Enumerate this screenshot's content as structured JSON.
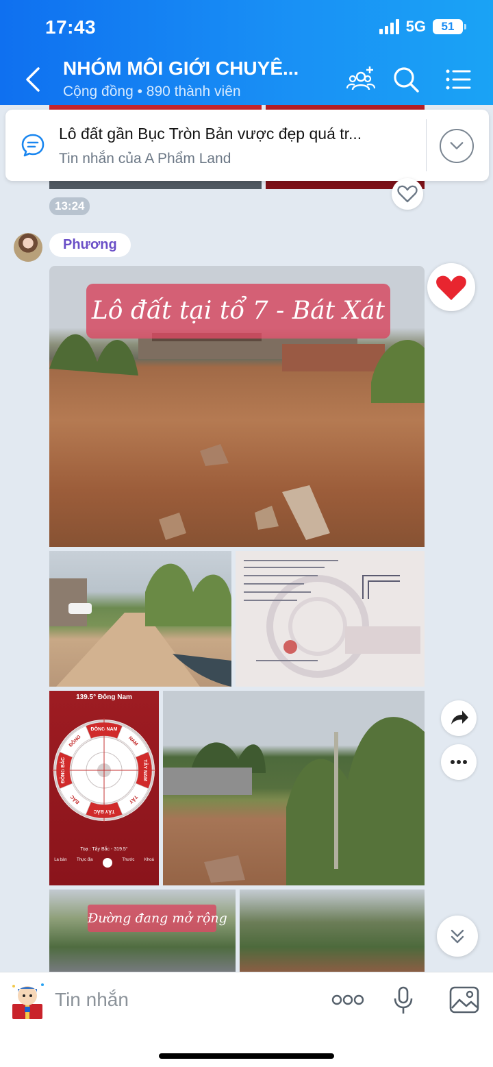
{
  "status": {
    "time": "17:43",
    "network": "5G",
    "battery": "51"
  },
  "header": {
    "title": "NHÓM MÔI GIỚI CHUYÊ...",
    "subtitle": "Cộng đồng • 890 thành viên"
  },
  "pinned": {
    "title": "Lô đất gần Bục Tròn Bản vược đẹp quá tr...",
    "subtitle": "Tin nhắn của A Phẩm Land"
  },
  "chat": {
    "prev_time": "13:24",
    "sender": "Phương",
    "photo_caption_main": "Lô đất tại tổ 7 - Bát Xát",
    "photo_caption_street": "Đường đang mở rộng",
    "compass_heading": "139.5° Đông Nam",
    "compass_footer": "Toạ : Tây Bắc - 319.5°",
    "compass_tabs": [
      "La bàn",
      "Thực địa",
      "",
      "Thước",
      "Khoá"
    ],
    "compass_dirs": [
      "ĐÔNG NAM",
      "NAM",
      "TÂY NAM",
      "TÂY",
      "TÂY BẮC",
      "BẮC",
      "ĐÔNG BẮC",
      "ĐÔNG"
    ]
  },
  "composer": {
    "placeholder": "Tin nhắn"
  },
  "icons": {
    "back": "back-arrow-icon",
    "add_member": "add-member-icon",
    "search": "search-icon",
    "menu": "menu-icon",
    "pinned": "chat-bubble-icon",
    "expand": "chevron-down-icon",
    "like": "heart-icon",
    "share": "share-icon",
    "more": "more-icon",
    "scroll_down": "double-chevron-down-icon",
    "mic": "microphone-icon",
    "gallery": "image-icon"
  },
  "colors": {
    "header_start": "#0f70f0",
    "header_end": "#1aa3f5",
    "sender": "#6a4fc7",
    "heart": "#e8252f",
    "bg": "#e2e9f1"
  }
}
